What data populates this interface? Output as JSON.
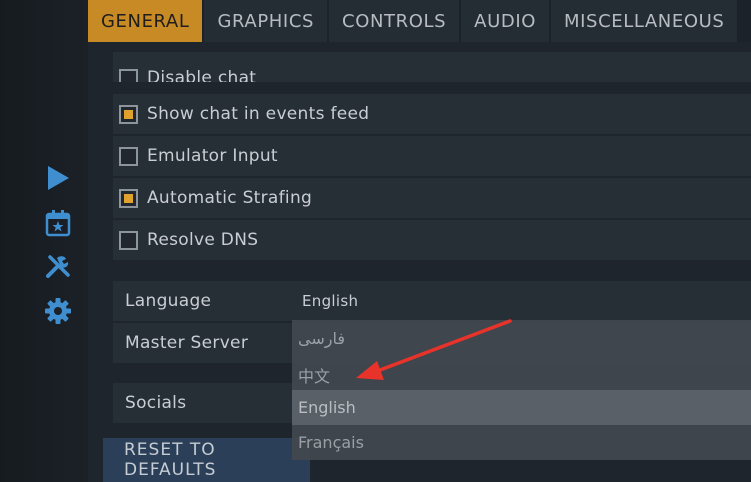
{
  "tabs": [
    {
      "label": "GENERAL",
      "active": true
    },
    {
      "label": "GRAPHICS",
      "active": false
    },
    {
      "label": "CONTROLS",
      "active": false
    },
    {
      "label": "AUDIO",
      "active": false
    },
    {
      "label": "MISCELLANEOUS",
      "active": false
    }
  ],
  "sidebar": {
    "icons": [
      "play-icon",
      "calendar-star-icon",
      "tools-icon",
      "gear-icon"
    ]
  },
  "settings": {
    "disable_chat": {
      "label": "Disable chat",
      "checked": false
    },
    "show_chat": {
      "label": "Show chat in events feed",
      "checked": true
    },
    "emulator_input": {
      "label": "Emulator Input",
      "checked": false
    },
    "auto_strafing": {
      "label": "Automatic Strafing",
      "checked": true
    },
    "resolve_dns": {
      "label": "Resolve DNS",
      "checked": false
    },
    "language": {
      "label": "Language",
      "value": "English"
    },
    "master_server": {
      "label": "Master Server"
    },
    "socials": {
      "label": "Socials"
    }
  },
  "reset_label": "RESET TO DEFAULTS",
  "dropdown": {
    "options": [
      "فارسی",
      "中文",
      "English",
      "Français"
    ],
    "highlighted": "English"
  },
  "colors": {
    "accent": "#c88a24",
    "check": "#e0a22d",
    "annotation_arrow": "#e8332a",
    "sidebar_icon": "#3f8fd0"
  }
}
